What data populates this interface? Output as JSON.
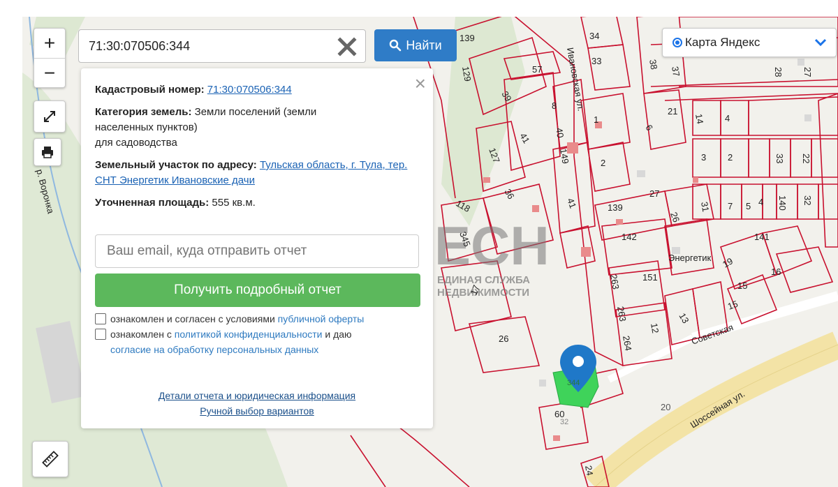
{
  "map": {
    "river_label": "р. Воронка",
    "street_labels": [
      "Ивановская ул.",
      "Советская",
      "Шоссейная ул.",
      "Энергетик"
    ],
    "parcel_numbers": [
      "139",
      "34",
      "33",
      "129",
      "57",
      "38",
      "37",
      "28",
      "27",
      "39",
      "8",
      "1",
      "21",
      "14",
      "4",
      "40",
      "149",
      "6",
      "3",
      "2",
      "33",
      "22",
      "127",
      "41",
      "41",
      "2",
      "31",
      "7",
      "5",
      "4",
      "140",
      "32",
      "118",
      "36",
      "139",
      "27",
      "26",
      "142",
      "141",
      "345",
      "19",
      "16",
      "15",
      "151",
      "15",
      "17",
      "26",
      "263",
      "263",
      "264",
      "12",
      "13",
      "60",
      "20",
      "24",
      "344",
      "32"
    ],
    "brand_top": "ЕСН",
    "brand_line1": "ЕДИНАЯ СЛУЖБА",
    "brand_line2": "НЕДВИЖИМОСТИ"
  },
  "controls": {
    "zoom_in": "+",
    "zoom_out": "−",
    "fullscreen_icon": "expand-icon",
    "print_icon": "printer-icon",
    "ruler_icon": "ruler-icon"
  },
  "search": {
    "value": "71:30:070506:344",
    "button_label": "Найти"
  },
  "layer_select": {
    "selected": "Карта Яндекс"
  },
  "info_panel": {
    "cadastral_label": "Кадастровый номер:",
    "cadastral_value": "71:30:070506:344",
    "category_label": "Категория земель:",
    "category_value": "Земли поселений (земли населенных пунктов)",
    "category_use": "для садоводства",
    "address_label": "Земельный участок по адресу:",
    "address_value": "Тульская область, г. Тула, тер. СНТ Энергетик Ивановские дачи",
    "area_label": "Уточненная площадь:",
    "area_value": "555 кв.м.",
    "email_placeholder": "Ваш email, куда отправить отчет",
    "get_report_button": "Получить подробный отчет",
    "consent1_text": "ознакомлен и согласен с условиями",
    "consent1_link": "публичной оферты",
    "consent2_text_a": "ознакомлен с",
    "consent2_link_a": "политикой конфиденциальности",
    "consent2_text_b": "и даю",
    "consent2_link_b": "согласие на обработку персональных данных",
    "details_link": "Детали отчета и юридическая информация",
    "manual_link": "Ручной выбор вариантов",
    "close": "×"
  },
  "colors": {
    "parcel_line": "#c8102e",
    "selected_parcel": "#3fd35a",
    "marker": "#1f78c8",
    "find_button": "#2f7cc7",
    "report_button": "#5cb85c"
  }
}
